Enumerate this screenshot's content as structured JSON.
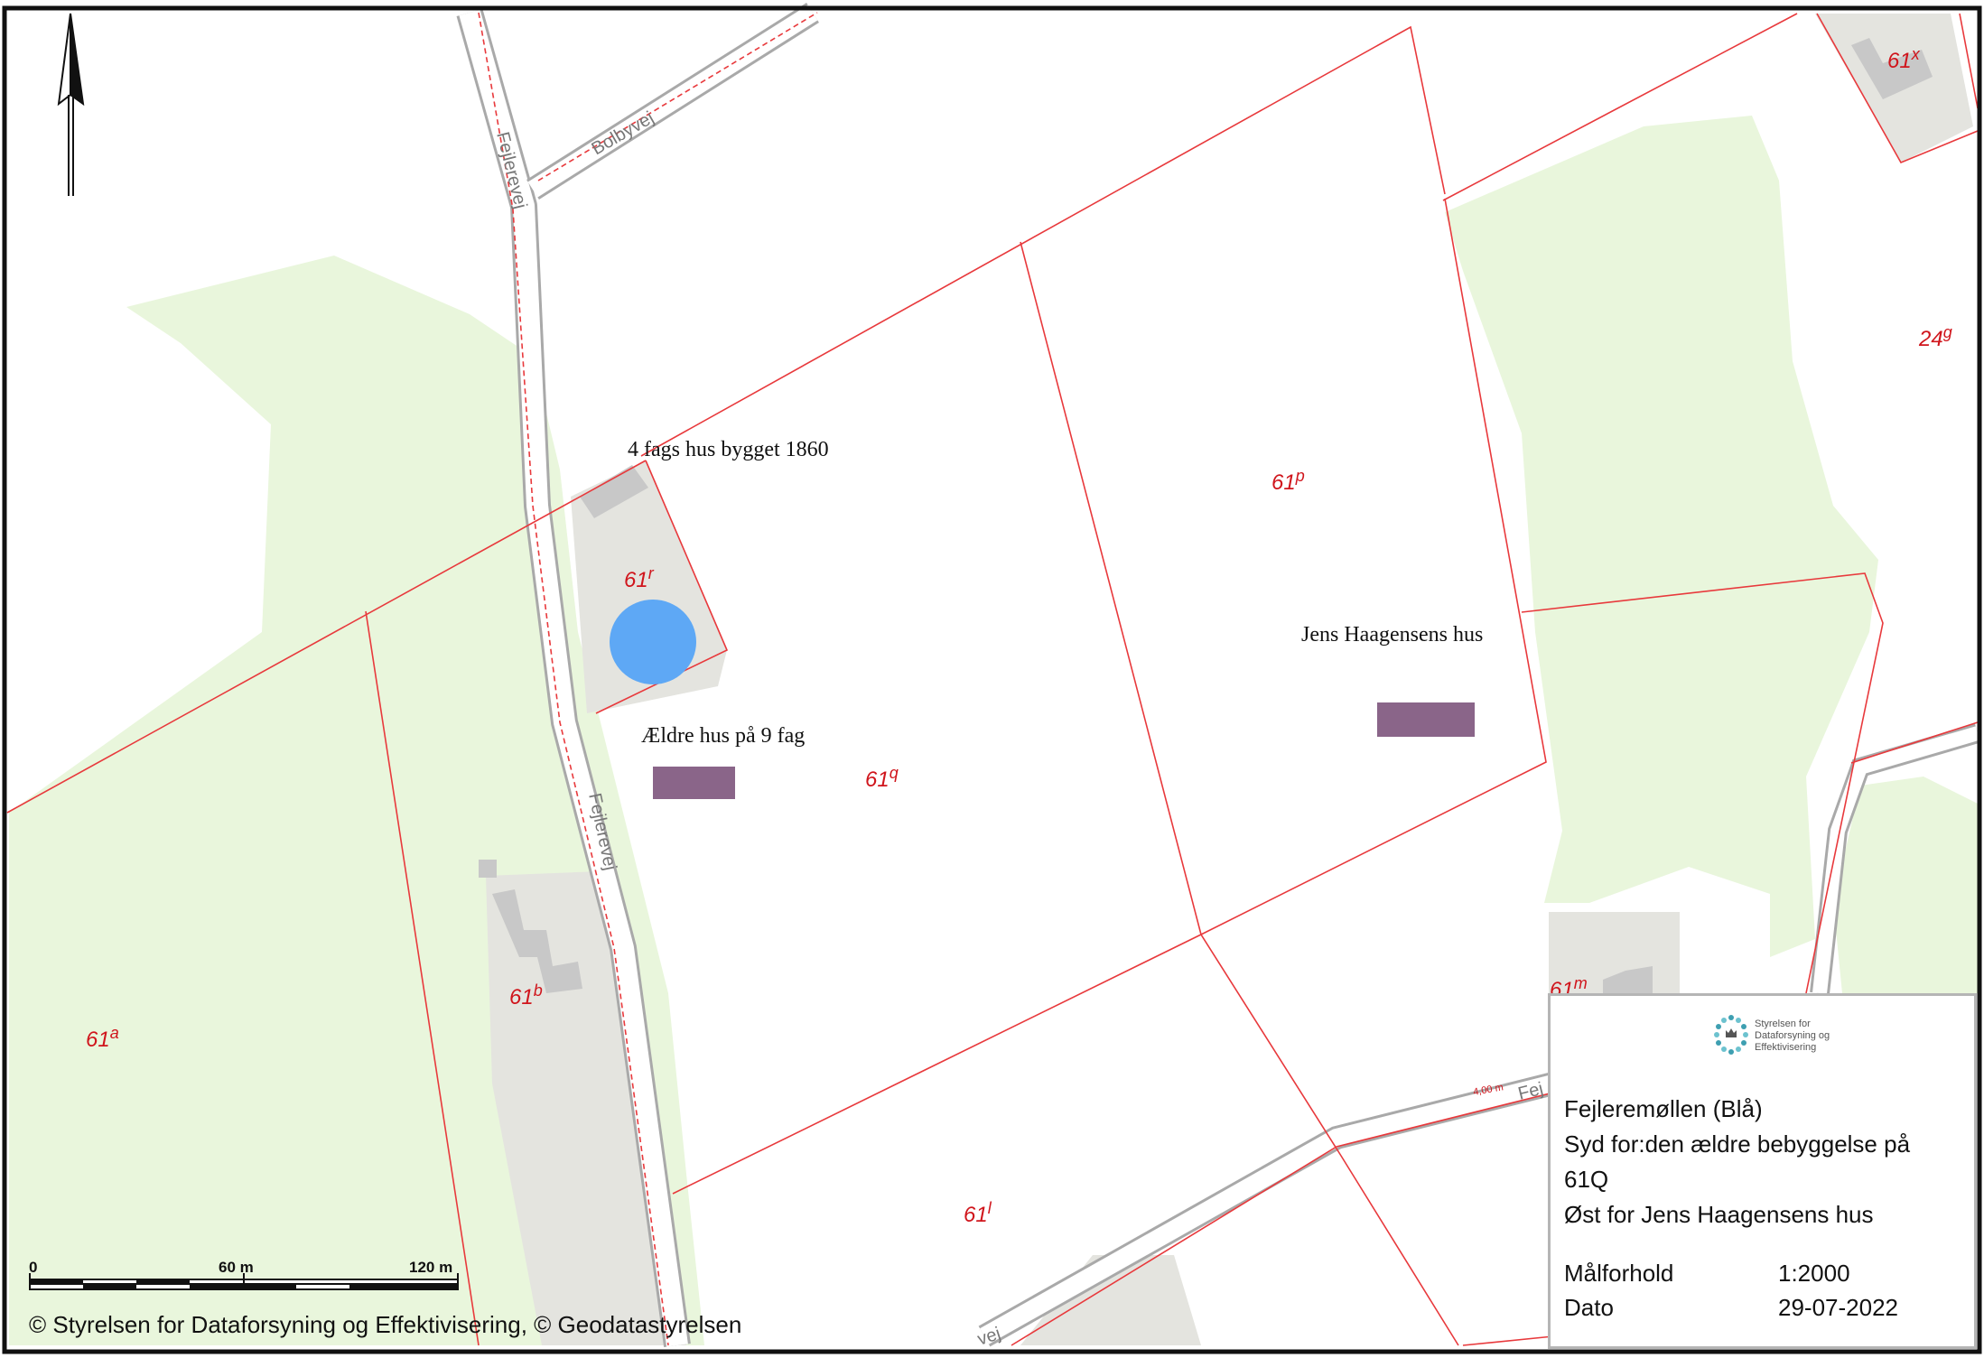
{
  "map": {
    "labels": {
      "road_fejlerevej_top": "Fejlerevej",
      "road_fejlerevej_bottom": "Fejlerevej",
      "road_bolbyvej": "Bolbyvej",
      "road_fej": "Fej",
      "road_vej_bottom": "vej",
      "road_width": "4,00 m"
    },
    "parcels": [
      {
        "id": "61x",
        "base": "61",
        "sup": "x"
      },
      {
        "id": "24g",
        "base": "24",
        "sup": "g"
      },
      {
        "id": "61p",
        "base": "61",
        "sup": "p"
      },
      {
        "id": "61r",
        "base": "61",
        "sup": "r"
      },
      {
        "id": "61q",
        "base": "61",
        "sup": "q"
      },
      {
        "id": "61b",
        "base": "61",
        "sup": "b"
      },
      {
        "id": "61a",
        "base": "61",
        "sup": "a"
      },
      {
        "id": "61m",
        "base": "61",
        "sup": "m"
      },
      {
        "id": "61l",
        "base": "61",
        "sup": "l"
      }
    ],
    "annotations": {
      "house_1860": "4 fags hus bygget 1860",
      "older_house": "Ældre hus på 9 fag",
      "jens_house": "Jens Haagensens hus"
    },
    "colors": {
      "parcel_line": "#e8393c",
      "forest": "#e9f6dc",
      "built_area": "#e4e4df",
      "building": "#c8c8c8",
      "road_fill": "#ffffff",
      "road_edge": "#a9a9a9",
      "marker_circle": "#5ea8f5",
      "marker_rect": "#8a6589",
      "label_red": "#d0151c"
    }
  },
  "scale": {
    "ticks": [
      "0",
      "60 m",
      "120 m"
    ]
  },
  "copyright": "© Styrelsen for Dataforsyning og Effektivisering, © Geodatastyrelsen",
  "info": {
    "agency_line1": "Styrelsen for",
    "agency_line2": "Dataforsyning og",
    "agency_line3": "Effektivisering",
    "title": "Fejleremøllen (Blå)",
    "desc1": "Syd for:den ældre bebyggelse på",
    "desc2": "61Q",
    "desc3": "Øst for Jens Haagensens hus",
    "scale_key": "Målforhold",
    "scale_val": "1:2000",
    "date_key": "Dato",
    "date_val": "29-07-2022"
  }
}
